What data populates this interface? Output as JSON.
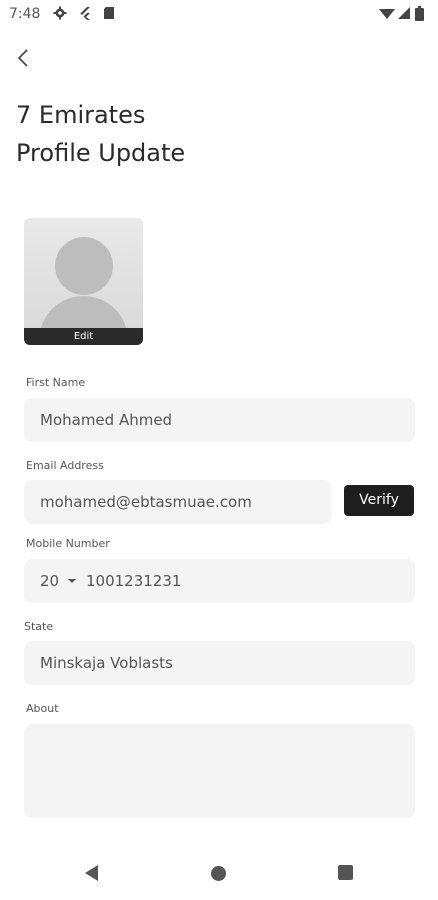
{
  "status_bar": {
    "time": "7:48",
    "icons": [
      "gear-icon",
      "flutter-icon",
      "sim-card-icon",
      "wifi-icon",
      "signal-icon",
      "battery-icon"
    ]
  },
  "header": {
    "back_icon": "chevron-left-icon",
    "title_line1": "7 Emirates",
    "title_line2": "Profile Update"
  },
  "avatar": {
    "edit_label": "Edit"
  },
  "form": {
    "first_name": {
      "label": "First Name",
      "value": "Mohamed Ahmed"
    },
    "email": {
      "label": "Email Address",
      "value": "mohamed@ebtasmuae.com",
      "verify_label": "Verify"
    },
    "mobile": {
      "label": "Mobile Number",
      "country_code": "20",
      "number": "1001231231"
    },
    "state": {
      "label": "State",
      "value": "Minskaja Voblasts"
    },
    "about": {
      "label": "About",
      "value": ""
    }
  },
  "nav_bar": {
    "icons": [
      "back-nav-icon",
      "home-nav-icon",
      "recents-nav-icon"
    ]
  }
}
